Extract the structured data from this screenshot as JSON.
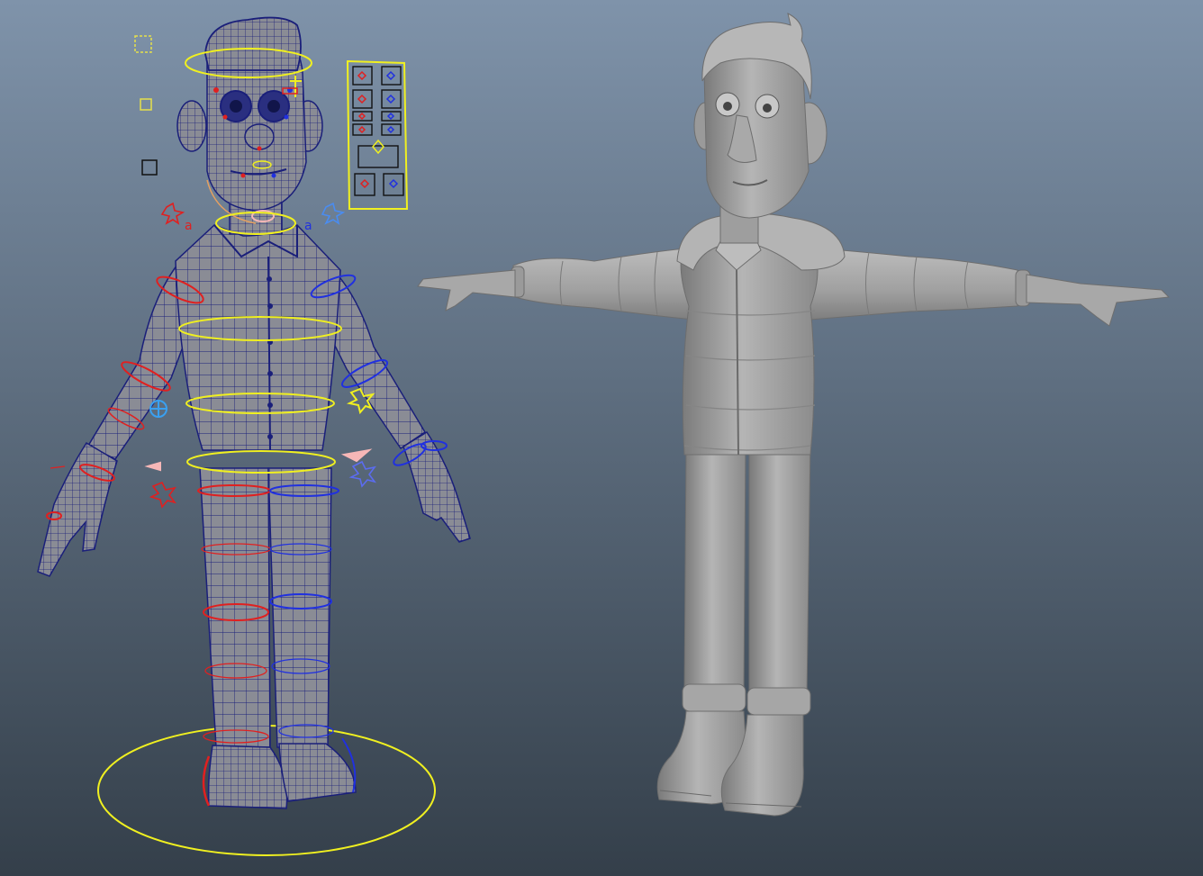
{
  "viewport": {
    "background_top": "#7f93aa",
    "background_bottom": "#343f4a"
  },
  "rigged_character": {
    "wireframe_color": "#1a1f7a",
    "mesh_fill": "#8a8c95",
    "left_control_color": "#e02020",
    "right_control_color": "#2030e0",
    "center_control_color": "#f0f020",
    "icons": [
      "square-control-icon",
      "diamond-control-icon",
      "circle-control-icon",
      "cross-control-icon"
    ]
  },
  "shaded_character": {
    "fill": "#a3a3a3",
    "shadow": "#7a7a7a",
    "highlight": "#c4c4c4",
    "pose": "T-pose"
  },
  "facial_panel": {
    "frame_color": "#f0f020",
    "slot_count": 12
  }
}
